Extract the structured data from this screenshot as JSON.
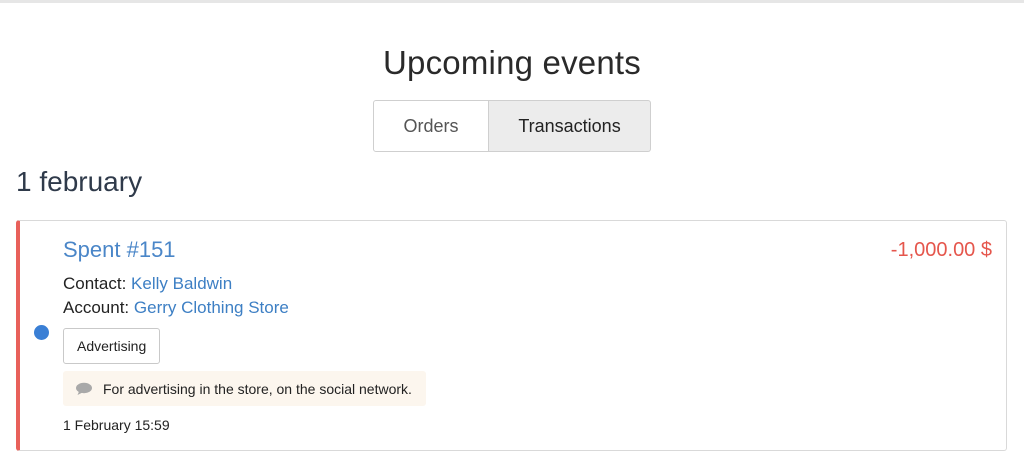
{
  "page": {
    "title": "Upcoming events"
  },
  "tabs": [
    {
      "label": "Orders",
      "active": false
    },
    {
      "label": "Transactions",
      "active": true
    }
  ],
  "date_group": {
    "heading": "1 february"
  },
  "event": {
    "title": "Spent #151",
    "amount": "-1,000.00 $",
    "contact_label": "Contact:",
    "contact_value": "Kelly Baldwin",
    "account_label": "Account:",
    "account_value": "Gerry Clothing Store",
    "tag": "Advertising",
    "comment": "For advertising in the store, on the social network.",
    "comment_icon": "speech-bubble-icon",
    "timestamp": "1 February 15:59",
    "status_dot_color": "#3a7fd5",
    "accent_color": "#e8605a"
  },
  "colors": {
    "link": "#3d7fc4",
    "amount_negative": "#e5564c",
    "active_tab_bg": "#ececec",
    "comment_bg": "#fcf6ee"
  }
}
